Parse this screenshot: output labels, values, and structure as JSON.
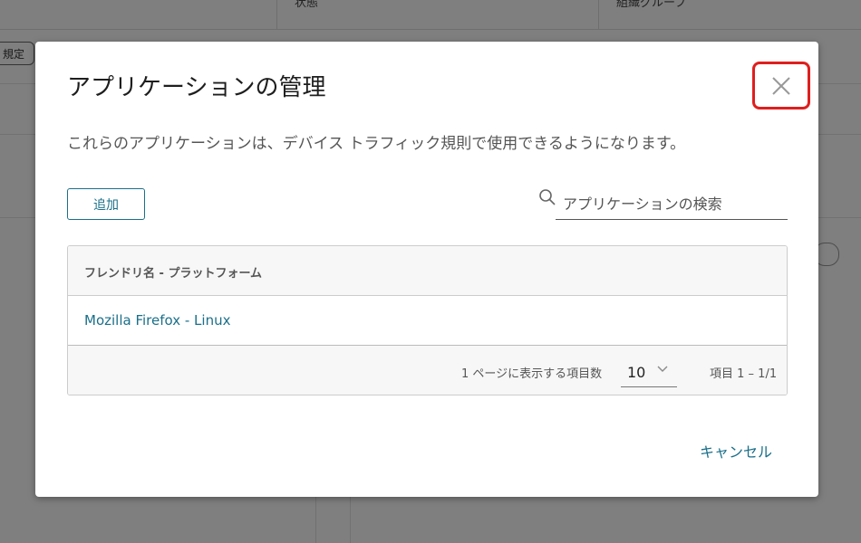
{
  "background": {
    "columns": [
      "状態",
      "組織グループ"
    ],
    "button_label": "規定"
  },
  "modal": {
    "title": "アプリケーションの管理",
    "description": "これらのアプリケーションは、デバイス トラフィック規則で使用できるようになります。",
    "add_label": "追加",
    "search_placeholder": "アプリケーションの検索",
    "close_icon": "close-icon",
    "highlight_color": "#e01e1e",
    "accent_color": "#1a6f8a",
    "grid": {
      "column_header": "フレンドリ名 - プラットフォーム",
      "rows": [
        {
          "name": "Mozilla Firefox - Linux"
        }
      ],
      "footer": {
        "per_page_label": "1 ページに表示する項目数",
        "per_page_value": "10",
        "range_text": "項目 1 – 1/1"
      }
    },
    "cancel_label": "キャンセル"
  }
}
